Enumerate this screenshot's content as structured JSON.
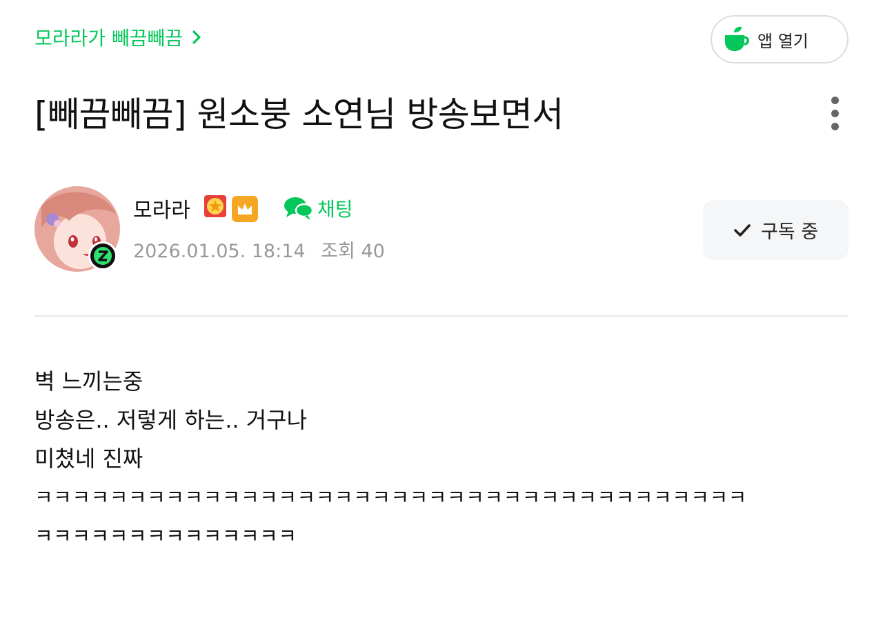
{
  "header": {
    "cafe_link_label": "모라라가 빼끔빼끔",
    "app_open_label": "앱 열기"
  },
  "post": {
    "title": "[빼끔빼끔] 원소붕 소연님 방송보면서",
    "author": {
      "name": "모라라",
      "chat_label": "채팅",
      "date": "2026.01.05. 18:14",
      "views_label": "조회",
      "views": "40"
    },
    "subscribe_label": "구독 중",
    "body_lines": [
      "벽 느끼는중",
      "방송은.. 저렇게 하는.. 거구나",
      "미쳤네 진짜",
      "ㅋㅋㅋㅋㅋㅋㅋㅋㅋㅋㅋㅋㅋㅋㅋㅋㅋㅋㅋㅋㅋㅋㅋㅋㅋㅋㅋㅋㅋㅋㅋㅋㅋㅋㅋㅋㅋㅋ",
      "ㅋㅋㅋㅋㅋㅋㅋㅋㅋㅋㅋㅋㅋㅋ"
    ]
  },
  "colors": {
    "accent": "#03c75a",
    "crown_badge": "#f5a623",
    "meta_text": "#999999"
  },
  "icons": {
    "cafe_chevron": "chevron-right-icon",
    "app": "coffee-cup-icon",
    "more": "more-vertical-icon",
    "level": "level-emblem-icon",
    "crown": "crown-icon",
    "chat": "chat-bubbles-icon",
    "subscribe": "check-icon"
  }
}
